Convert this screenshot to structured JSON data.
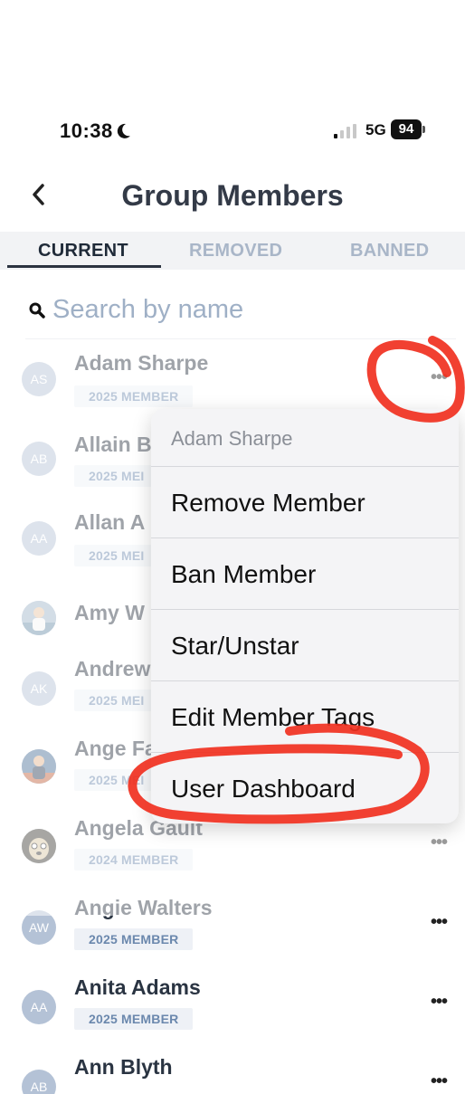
{
  "status_bar": {
    "time": "10:38",
    "network": "5G",
    "battery": "94"
  },
  "header": {
    "title": "Group Members"
  },
  "tabs": [
    {
      "label": "CURRENT",
      "active": true
    },
    {
      "label": "REMOVED",
      "active": false
    },
    {
      "label": "BANNED",
      "active": false
    }
  ],
  "search": {
    "placeholder": "Search by name"
  },
  "members": [
    {
      "initials": "AS",
      "name": "Adam Sharpe",
      "tag": "2025 MEMBER"
    },
    {
      "initials": "AB",
      "name": "Allain B",
      "tag": "2025 MEI"
    },
    {
      "initials": "AA",
      "name": "Allan A",
      "tag": "2025 MEI"
    },
    {
      "initials": "",
      "name": "Amy W",
      "tag": ""
    },
    {
      "initials": "AK",
      "name": "Andrew",
      "tag": "2025 MEI"
    },
    {
      "initials": "",
      "name": "Ange Fa",
      "tag": "2025 MEI"
    },
    {
      "initials": "",
      "name": "Angela Gault",
      "tag": "2024 MEMBER"
    },
    {
      "initials": "AW",
      "name": "Angie Walters",
      "tag": "2025 MEMBER"
    },
    {
      "initials": "AA",
      "name": "Anita Adams",
      "tag": "2025 MEMBER"
    },
    {
      "initials": "AB",
      "name": "Ann Blyth",
      "tag": ""
    }
  ],
  "more_icon_text": "•••",
  "context_menu": {
    "header": "Adam Sharpe",
    "items": [
      {
        "label": "Remove Member"
      },
      {
        "label": "Ban Member"
      },
      {
        "label": "Star/Unstar"
      },
      {
        "label": "Edit Member Tags"
      },
      {
        "label": "User Dashboard"
      }
    ]
  },
  "colors": {
    "accent_text": "#2b3340",
    "inactive_tab": "#a9b6c8",
    "avatar_bg": "#b4c2d6",
    "tag_text": "#6b88ad",
    "annotation_red": "#f0301f"
  }
}
